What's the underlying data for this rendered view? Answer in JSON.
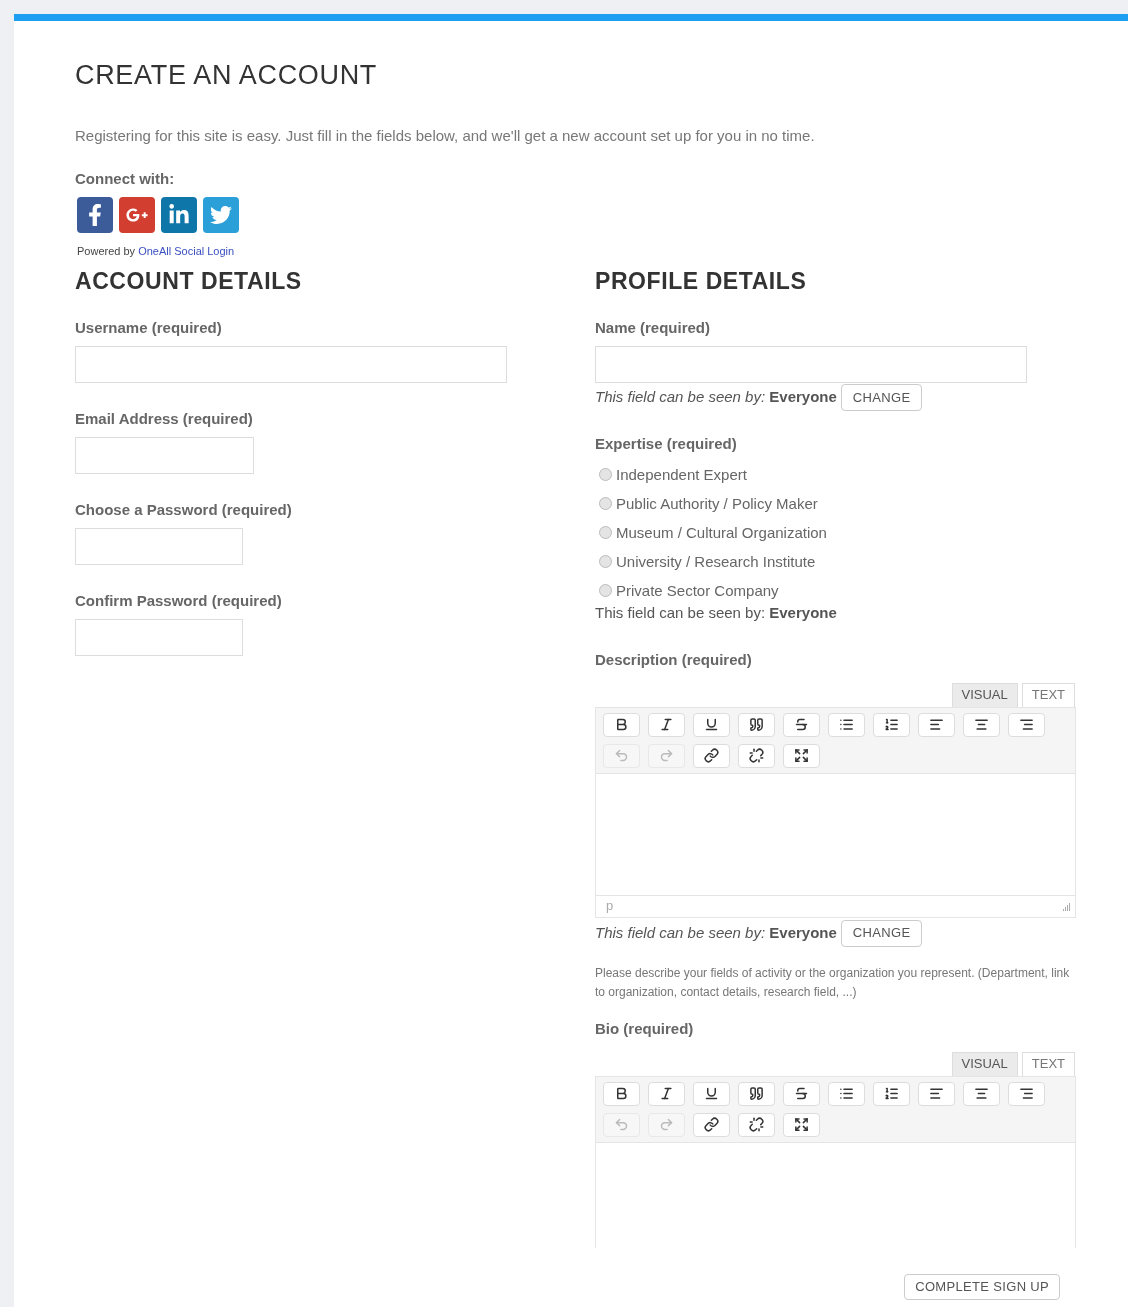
{
  "page_title": "CREATE AN ACCOUNT",
  "intro": "Registering for this site is easy. Just fill in the fields below, and we'll get a new account set up for you in no time.",
  "social": {
    "label": "Connect with:",
    "providers": [
      {
        "kind": "facebook"
      },
      {
        "kind": "google"
      },
      {
        "kind": "linkedin"
      },
      {
        "kind": "twitter"
      }
    ],
    "powered_by": "Powered by",
    "powered_link": "OneAll Social Login"
  },
  "account": {
    "heading": "ACCOUNT DETAILS",
    "fields": [
      {
        "label": "Username (required)",
        "kind": "text"
      },
      {
        "label": "Email Address (required)",
        "kind": "email"
      },
      {
        "label": "Choose a Password (required)",
        "kind": "password"
      },
      {
        "label": "Confirm Password (required)",
        "kind": "password"
      }
    ]
  },
  "profile": {
    "heading": "PROFILE DETAILS",
    "name": {
      "label": "Name (required)",
      "visibility": "*This field can be seen by:* **Everyone**",
      "change_button": "CHANGE"
    },
    "expertise": {
      "label": "Expertise (required)",
      "options": [
        {
          "label": "Independent Expert",
          "selected": false
        },
        {
          "label": "Public Authority / Policy Maker",
          "selected": false
        },
        {
          "label": "Museum / Cultural Organization",
          "selected": false
        },
        {
          "label": "University / Research Institute",
          "selected": false
        },
        {
          "label": "Private Sector Company",
          "selected": false
        }
      ],
      "visibility": "This field can be seen by: **Everyone**"
    },
    "description": {
      "label": "Description (required)",
      "tabs": [
        {
          "label": "VISUAL",
          "selected": true
        },
        {
          "label": "TEXT",
          "selected": false
        }
      ],
      "toolbar": [
        {
          "buttons": [
            {
              "kind": "bold",
              "disabled": false
            },
            {
              "kind": "italic",
              "disabled": false
            },
            {
              "kind": "underline",
              "disabled": false
            },
            {
              "kind": "quote",
              "disabled": false
            },
            {
              "kind": "strikethrough",
              "disabled": false
            },
            {
              "kind": "bullets",
              "disabled": false
            },
            {
              "kind": "numbers",
              "disabled": false
            },
            {
              "kind": "align-left",
              "disabled": false
            },
            {
              "kind": "align-center",
              "disabled": false
            },
            {
              "kind": "align-right",
              "disabled": false
            }
          ]
        },
        {
          "buttons": [
            {
              "kind": "undo",
              "disabled": true
            },
            {
              "kind": "redo",
              "disabled": true
            },
            {
              "kind": "link",
              "disabled": false
            },
            {
              "kind": "unlink",
              "disabled": false
            },
            {
              "kind": "fullscreen",
              "disabled": false
            }
          ]
        }
      ],
      "status_path": "p",
      "visibility": "*This field can be seen by:* **Everyone**",
      "change_button": "CHANGE",
      "help": "Please describe your fields of activity or the organization you represent. (Department, link to organization, contact details, research field, ...)"
    },
    "bio": {
      "label": "Bio (required)",
      "tabs": [
        {
          "label": "VISUAL",
          "selected": true
        },
        {
          "label": "TEXT",
          "selected": false
        }
      ],
      "toolbar": [
        {
          "buttons": [
            {
              "kind": "bold",
              "disabled": false
            },
            {
              "kind": "italic",
              "disabled": false
            },
            {
              "kind": "underline",
              "disabled": false
            },
            {
              "kind": "quote",
              "disabled": false
            },
            {
              "kind": "strikethrough",
              "disabled": false
            },
            {
              "kind": "bullets",
              "disabled": false
            },
            {
              "kind": "numbers",
              "disabled": false
            },
            {
              "kind": "align-left",
              "disabled": false
            },
            {
              "kind": "align-center",
              "disabled": false
            },
            {
              "kind": "align-right",
              "disabled": false
            }
          ]
        },
        {
          "buttons": [
            {
              "kind": "undo",
              "disabled": true
            },
            {
              "kind": "redo",
              "disabled": true
            },
            {
              "kind": "link",
              "disabled": false
            },
            {
              "kind": "unlink",
              "disabled": false
            },
            {
              "kind": "fullscreen",
              "disabled": false
            }
          ]
        }
      ]
    }
  },
  "submit": "COMPLETE SIGN UP"
}
